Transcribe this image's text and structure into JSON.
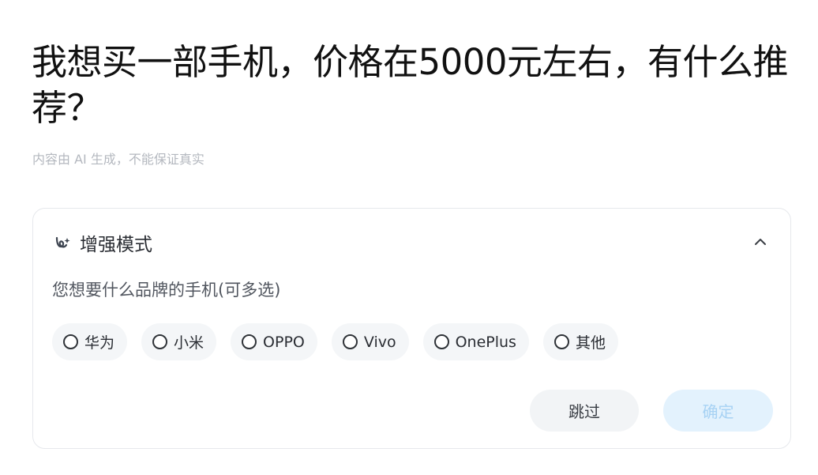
{
  "question": "我想买一部手机，价格在5000元左右，有什么推荐？",
  "disclaimer": "内容由 AI 生成，不能保证真实",
  "card": {
    "mode_icon": "enhanced-mode-icon",
    "mode_title": "增强模式",
    "collapse_icon": "chevron-up-icon",
    "prompt": "您想要什么品牌的手机(可多选)",
    "options": [
      {
        "label": "华为",
        "selected": false
      },
      {
        "label": "小米",
        "selected": false
      },
      {
        "label": "OPPO",
        "selected": false
      },
      {
        "label": "Vivo",
        "selected": false
      },
      {
        "label": "OnePlus",
        "selected": false
      },
      {
        "label": "其他",
        "selected": false
      }
    ],
    "skip_label": "跳过",
    "confirm_label": "确定",
    "confirm_enabled": false
  },
  "colors": {
    "confirm_bg": "#e3f2fd",
    "confirm_text": "#a7d2f4",
    "option_bg": "#f4f6f8"
  }
}
